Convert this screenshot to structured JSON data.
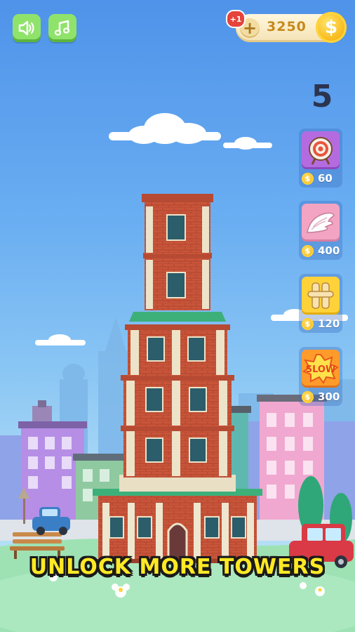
{
  "hud": {
    "sound_icon": "speaker-icon",
    "music_icon": "music-note-icon",
    "coin_bonus_badge": "+1",
    "coins": "3250",
    "add_coins_icon": "plus-icon",
    "coin_icon": "dollar-coin-icon",
    "level": "5"
  },
  "shop": {
    "items": [
      {
        "name": "target-powerup",
        "icon": "archery-target-icon",
        "price": "60",
        "color": "#b56be0"
      },
      {
        "name": "wings-powerup",
        "icon": "wings-icon",
        "price": "400",
        "color": "#f2a4c2"
      },
      {
        "name": "columns-powerup",
        "icon": "pillars-icon",
        "price": "120",
        "color": "#ffd23a"
      },
      {
        "name": "slow-powerup",
        "icon": "slow-badge-icon",
        "label": "SLOW",
        "price": "300",
        "color": "#ff9b2b"
      }
    ]
  },
  "banner": {
    "text": "UNLOCK MORE TOWERS"
  },
  "colors": {
    "sky_top": "#4f93ea",
    "button_green": "#8fe36a",
    "banner_yellow": "#ffe924",
    "brick": "#c9563a"
  }
}
